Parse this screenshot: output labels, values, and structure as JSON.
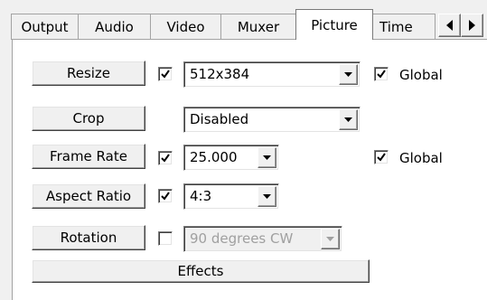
{
  "tabs": [
    {
      "label": "Output"
    },
    {
      "label": "Audio"
    },
    {
      "label": "Video"
    },
    {
      "label": "Muxer"
    },
    {
      "label": "Picture",
      "selected": true
    },
    {
      "label": "Time"
    }
  ],
  "tab_scroll": {
    "left_icon": "arrow-left-icon",
    "right_icon": "arrow-right-icon"
  },
  "picture": {
    "resize": {
      "button": "Resize",
      "enabled_checked": true,
      "value": "512x384",
      "global_checked": true,
      "global_label": "Global"
    },
    "crop": {
      "button": "Crop",
      "value": "Disabled"
    },
    "frame_rate": {
      "button": "Frame Rate",
      "enabled_checked": true,
      "value": "25.000",
      "global_checked": true,
      "global_label": "Global"
    },
    "aspect_ratio": {
      "button": "Aspect Ratio",
      "enabled_checked": true,
      "value": "4:3"
    },
    "rotation": {
      "button": "Rotation",
      "enabled_checked": false,
      "value": "90 degrees CW",
      "value_disabled": true
    },
    "effects": {
      "button": "Effects"
    }
  },
  "colors": {
    "panel_bg": "#ffffff",
    "window_bg": "#f0f0f0",
    "disabled_text": "#a0a0a0"
  }
}
